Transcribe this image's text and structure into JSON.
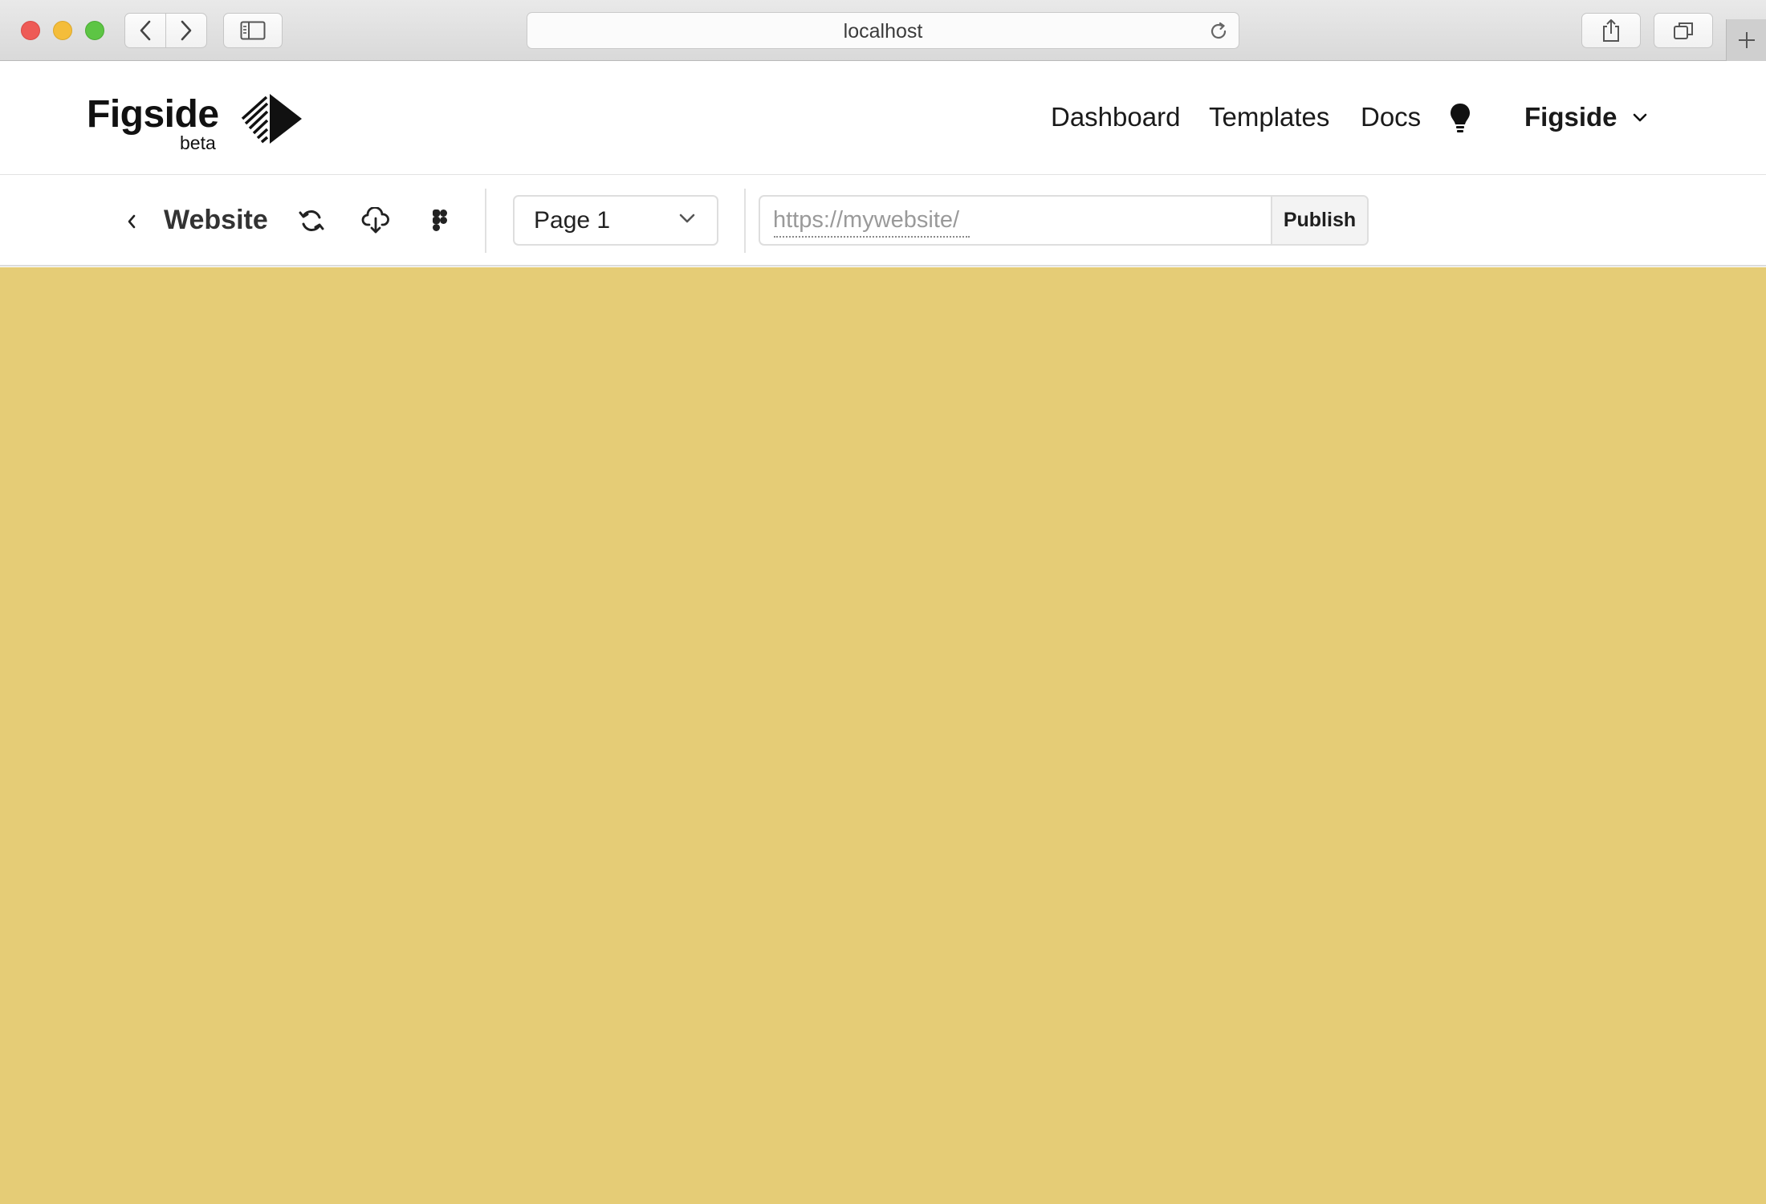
{
  "browser": {
    "address": "localhost"
  },
  "header": {
    "logo_text": "Figside",
    "logo_badge": "beta",
    "nav": {
      "dashboard": "Dashboard",
      "templates": "Templates",
      "docs": "Docs"
    },
    "account_name": "Figside"
  },
  "toolbar": {
    "project_name": "Website",
    "page_select": "Page 1",
    "url_placeholder": "https://mywebsite/",
    "url_value": "",
    "publish_label": "Publish"
  },
  "colors": {
    "canvas_background": "#e5cc76",
    "accent": "#111111"
  }
}
